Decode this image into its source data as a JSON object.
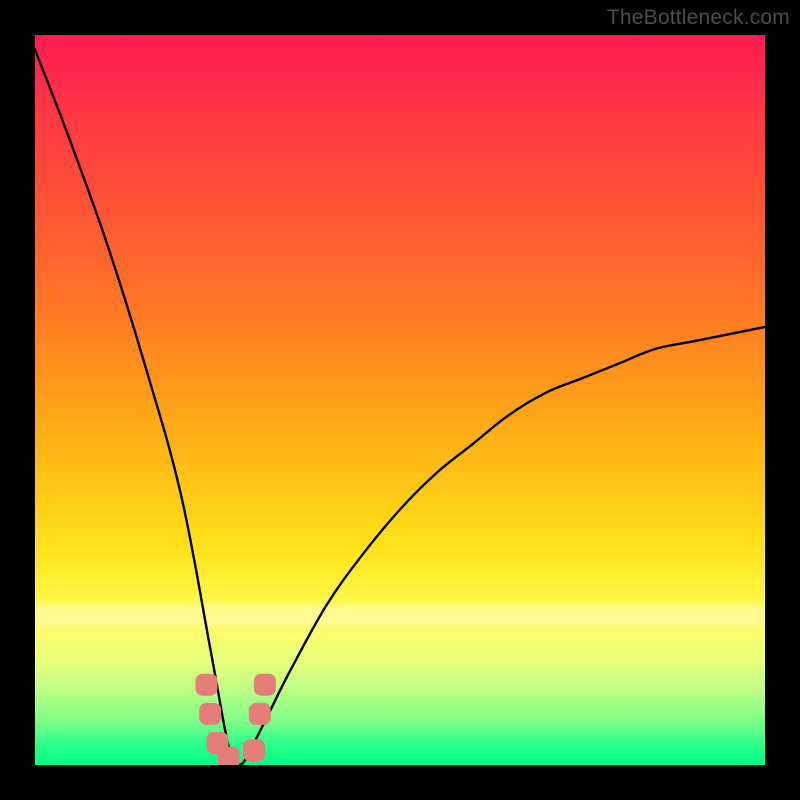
{
  "watermark": "TheBottleneck.com",
  "chart_data": {
    "type": "line",
    "title": "",
    "xlabel": "",
    "ylabel": "",
    "xlim": [
      0,
      100
    ],
    "ylim": [
      0,
      100
    ],
    "grid": false,
    "legend": false,
    "notes": "V-shaped bottleneck curve over red-to-green gradient. Minimum (~0) around x≈28; y rises toward ~98 at x=0 and ~60 at x=100. Pink markers cluster near the minimum on the safe (green) band.",
    "series": [
      {
        "name": "bottleneck-curve",
        "x": [
          0,
          5,
          10,
          15,
          20,
          24,
          26,
          27,
          28,
          29,
          30,
          32,
          35,
          40,
          45,
          50,
          55,
          60,
          65,
          70,
          75,
          80,
          85,
          90,
          95,
          100
        ],
        "values": [
          98,
          85,
          71,
          55,
          37,
          16,
          5,
          1,
          0,
          1,
          3,
          7,
          13,
          22,
          29,
          35,
          40,
          44,
          48,
          51,
          53,
          55,
          57,
          58,
          59,
          60
        ]
      }
    ],
    "markers": [
      {
        "x": 23.5,
        "y": 11
      },
      {
        "x": 24.0,
        "y": 7
      },
      {
        "x": 25.0,
        "y": 3
      },
      {
        "x": 26.5,
        "y": 1
      },
      {
        "x": 30.0,
        "y": 2
      },
      {
        "x": 30.8,
        "y": 7
      },
      {
        "x": 31.5,
        "y": 11
      }
    ],
    "gradient_stops": [
      {
        "pos": 0,
        "meaning": "severe-bottleneck",
        "color": "#ff1a52"
      },
      {
        "pos": 50,
        "meaning": "moderate",
        "color": "#ff9a18"
      },
      {
        "pos": 80,
        "meaning": "mild",
        "color": "#fff84a"
      },
      {
        "pos": 100,
        "meaning": "no-bottleneck",
        "color": "#04ff85"
      }
    ]
  }
}
